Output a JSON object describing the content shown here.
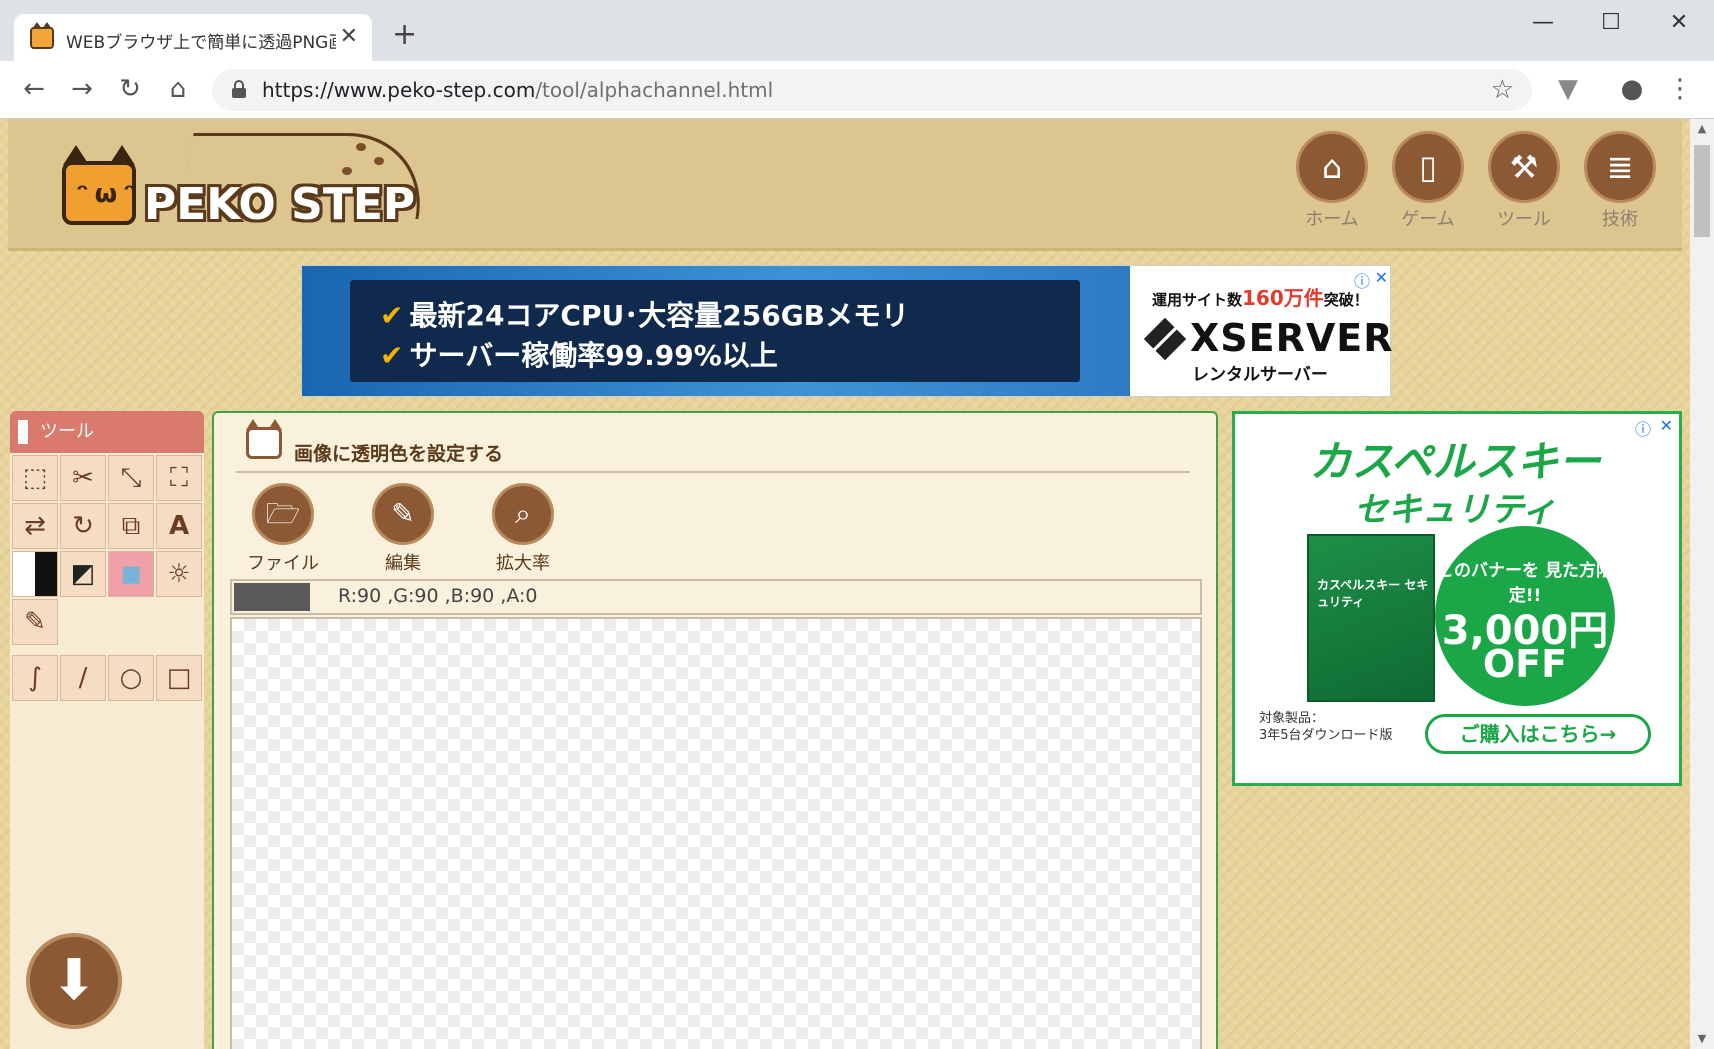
{
  "browser": {
    "tab_title": "WEBブラウザ上で簡単に透過PNG画",
    "tab_close": "✕",
    "new_tab": "+",
    "window_controls": {
      "minimize": "—",
      "maximize": "☐",
      "close": "✕"
    },
    "url_host": "https://www.peko-step.com",
    "url_path": "/tool/alphachannel.html",
    "icons": {
      "back": "back-arrow-icon",
      "forward": "forward-arrow-icon",
      "reload": "reload-icon",
      "home": "home-icon",
      "star": "bookmark-star-icon",
      "account": "account-icon",
      "menu": "kebab-menu-icon"
    }
  },
  "site": {
    "logo_text": "PEKO STEP",
    "nav": [
      {
        "label": "ホーム",
        "icon": "house-icon"
      },
      {
        "label": "ゲーム",
        "icon": "smartphone-icon"
      },
      {
        "label": "ツール",
        "icon": "tools-icon"
      },
      {
        "label": "技術",
        "icon": "document-icon"
      }
    ],
    "accent": "#8b5a35",
    "background": "#e8d49a"
  },
  "ad_top": {
    "line1": "最新24コアCPU･大容量256GBメモリ",
    "line2": "サーバー稼働率99.99%以上",
    "small_pre": "運用サイト数",
    "small_num": "160万件",
    "small_post": "突破！",
    "brand": "XSERVER",
    "brand_sub": "レンタルサーバー"
  },
  "tools": {
    "title": "ツール",
    "buttons": [
      "rect-select-icon",
      "scissors-icon",
      "resize-icon",
      "crop-icon",
      "swap-icon",
      "rotate-icon",
      "copy-add-icon",
      "text-icon",
      "invert-icon",
      "grayscale-icon",
      "transparent-color-icon",
      "brightness-icon",
      "eyedropper-icon"
    ],
    "draw_buttons": [
      "freehand-icon",
      "line-icon",
      "circle-icon",
      "rectangle-icon"
    ],
    "text_tool_glyph": "A",
    "download_icon": "download-arrow-icon"
  },
  "main": {
    "title": "画像に透明色を設定する",
    "buttons": [
      {
        "label": "ファイル",
        "icon": "folder-icon"
      },
      {
        "label": "編集",
        "icon": "pencil-icon"
      },
      {
        "label": "拡大率",
        "icon": "magnifier-icon"
      }
    ],
    "color_readout": "R:90 ,G:90 ,B:90 ,A:0",
    "swatch_color": "#5a5a5a"
  },
  "ad_side": {
    "title": "カスペルスキー",
    "subtitle": "セキュリティ",
    "box_text": "カスペルスキー セキュリティ",
    "circle_line1": "このバナーを 見た方限定!!",
    "circle_price": "3,000円",
    "circle_off": "OFF",
    "note_line1": "対象製品：",
    "note_line2": "3年5台ダウンロード版",
    "cta": "ご購入はこちら→",
    "brand_color": "#1ba648"
  }
}
